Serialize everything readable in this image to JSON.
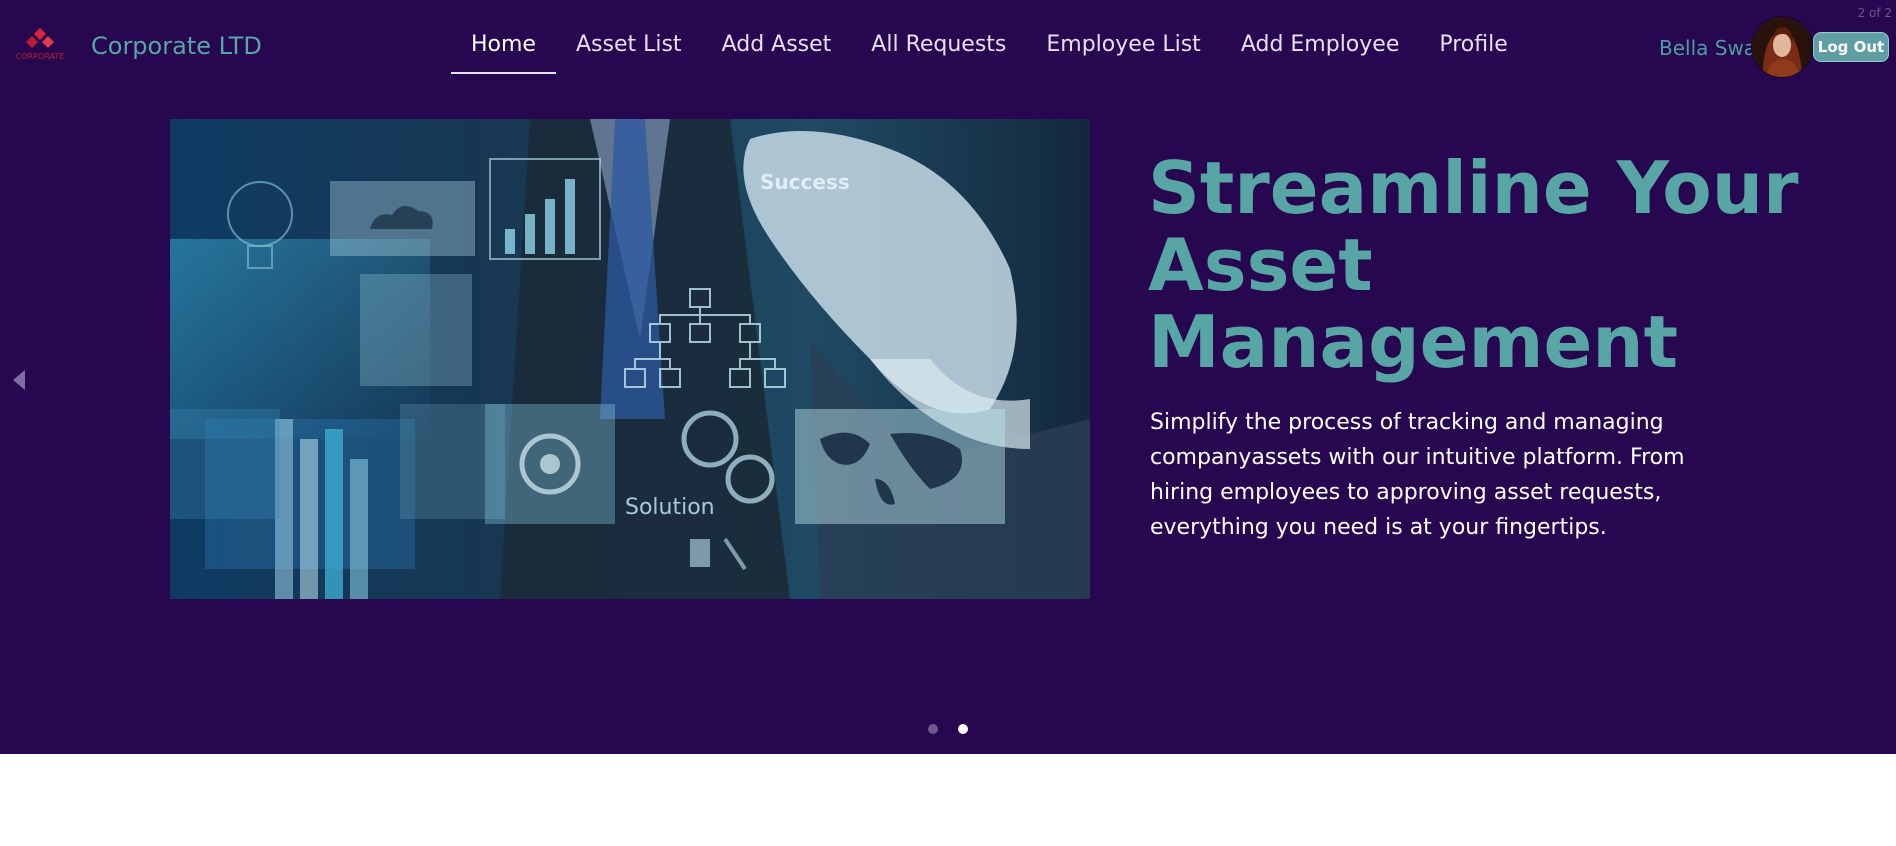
{
  "brand": {
    "logo_text": "CORPORATE",
    "name": "Corporate LTD"
  },
  "nav": {
    "items": [
      {
        "label": "Home",
        "active": true
      },
      {
        "label": "Asset List"
      },
      {
        "label": "Add Asset"
      },
      {
        "label": "All Requests"
      },
      {
        "label": "Employee List"
      },
      {
        "label": "Add Employee"
      },
      {
        "label": "Profile"
      }
    ]
  },
  "user": {
    "name": "Bella Swan",
    "logout_label": "Log Out"
  },
  "carousel": {
    "counter": "2 of 2",
    "current_slide": 2,
    "total_slides": 2,
    "headline": "Streamline Your Asset Management",
    "description": "Simplify the process of tracking and managing companyassets with our intuitive platform. From hiring employees to approving asset requests, everything you need is at your fingertips.",
    "image_texts": [
      "Success",
      "Solution"
    ],
    "icons": {
      "prev": "chevron-left-icon"
    }
  },
  "colors": {
    "hero_bg": "#270750",
    "accent": "#57a5a5",
    "logout_bg": "#5f9ea2",
    "logo_red": "#d6263d"
  }
}
